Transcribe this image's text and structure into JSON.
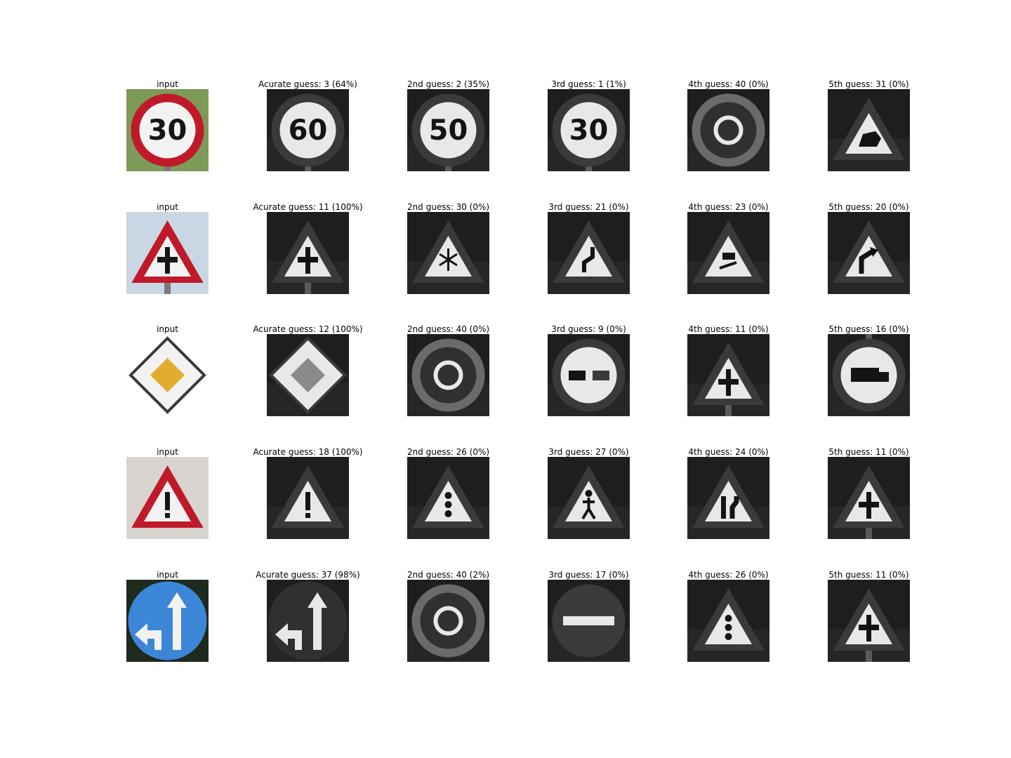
{
  "grid": {
    "rows": [
      {
        "cells": [
          {
            "title": "input",
            "icon": "speed-limit-30-sign",
            "color": true,
            "label": "30"
          },
          {
            "title": "Acurate guess: 3 (64%)",
            "icon": "speed-limit-60-sign",
            "label": "60"
          },
          {
            "title": "2nd guess: 2 (35%)",
            "icon": "speed-limit-50-sign",
            "label": "50"
          },
          {
            "title": "3rd guess: 1 (1%)",
            "icon": "speed-limit-30-sign",
            "label": "30"
          },
          {
            "title": "4th guess: 40 (0%)",
            "icon": "roundabout-sign"
          },
          {
            "title": "5th guess: 31 (0%)",
            "icon": "wild-animals-sign"
          }
        ]
      },
      {
        "cells": [
          {
            "title": "input",
            "icon": "right-of-way-intersection-sign",
            "color": true
          },
          {
            "title": "Acurate guess: 11 (100%)",
            "icon": "right-of-way-intersection-sign"
          },
          {
            "title": "2nd guess: 30 (0%)",
            "icon": "ice-snow-sign"
          },
          {
            "title": "3rd guess: 21 (0%)",
            "icon": "double-curve-sign"
          },
          {
            "title": "4th guess: 23 (0%)",
            "icon": "slippery-road-sign"
          },
          {
            "title": "5th guess: 20 (0%)",
            "icon": "curve-right-sign"
          }
        ]
      },
      {
        "cells": [
          {
            "title": "input",
            "icon": "priority-road-sign",
            "color": true
          },
          {
            "title": "Acurate guess: 12 (100%)",
            "icon": "priority-road-sign"
          },
          {
            "title": "2nd guess: 40 (0%)",
            "icon": "roundabout-sign"
          },
          {
            "title": "3rd guess: 9 (0%)",
            "icon": "no-passing-sign"
          },
          {
            "title": "4th guess: 11 (0%)",
            "icon": "right-of-way-intersection-sign"
          },
          {
            "title": "5th guess: 16 (0%)",
            "icon": "no-trucks-sign"
          }
        ]
      },
      {
        "cells": [
          {
            "title": "input",
            "icon": "general-caution-sign",
            "color": true
          },
          {
            "title": "Acurate guess: 18 (100%)",
            "icon": "general-caution-sign"
          },
          {
            "title": "2nd guess: 26 (0%)",
            "icon": "traffic-signals-sign"
          },
          {
            "title": "3rd guess: 27 (0%)",
            "icon": "pedestrians-sign"
          },
          {
            "title": "4th guess: 24 (0%)",
            "icon": "road-narrows-sign"
          },
          {
            "title": "5th guess: 11 (0%)",
            "icon": "right-of-way-intersection-sign"
          }
        ]
      },
      {
        "cells": [
          {
            "title": "input",
            "icon": "go-straight-or-left-sign",
            "color": true
          },
          {
            "title": "Acurate guess: 37 (98%)",
            "icon": "go-straight-or-left-sign"
          },
          {
            "title": "2nd guess: 40 (2%)",
            "icon": "roundabout-sign"
          },
          {
            "title": "3rd guess: 17 (0%)",
            "icon": "no-entry-sign"
          },
          {
            "title": "4th guess: 26 (0%)",
            "icon": "traffic-signals-sign"
          },
          {
            "title": "5th guess: 11 (0%)",
            "icon": "right-of-way-intersection-sign"
          }
        ]
      }
    ]
  }
}
